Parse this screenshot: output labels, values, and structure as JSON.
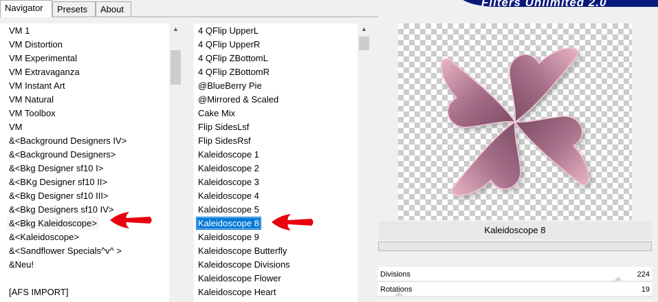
{
  "tabs": [
    {
      "label": "Navigator",
      "active": true
    },
    {
      "label": "Presets",
      "active": false
    },
    {
      "label": "About",
      "active": false
    }
  ],
  "brand": {
    "title": "Filters Unlimited 2.0"
  },
  "categories": {
    "items": [
      "VM 1",
      "VM Distortion",
      "VM Experimental",
      "VM Extravaganza",
      "VM Instant Art",
      "VM Natural",
      "VM Toolbox",
      "VM",
      "&<Background Designers IV>",
      "&<Background Designers>",
      "&<Bkg Designer sf10 I>",
      "&<BKg Designer sf10 II>",
      "&<Bkg Designer sf10 III>",
      "&<Bkg Designers sf10 IV>",
      "&<Bkg Kaleidoscope>",
      "&<Kaleidoscope>",
      "&<Sandflower Specials^v^ >",
      "&Neu!",
      "",
      "[AFS IMPORT]"
    ],
    "highlighted_index": 14,
    "scroll_fraction": 0.1
  },
  "filters": {
    "items": [
      "4 QFlip UpperL",
      "4 QFlip UpperR",
      "4 QFlip ZBottomL",
      "4 QFlip ZBottomR",
      "@BlueBerry Pie",
      "@Mirrored & Scaled",
      "Cake Mix",
      "Flip SidesLsf",
      "Flip SidesRsf",
      "Kaleidoscope 1",
      "Kaleidoscope 2",
      "Kaleidoscope 3",
      "Kaleidoscope 4",
      "Kaleidoscope 5",
      "Kaleidoscope 8",
      "Kaleidoscope 9",
      "Kaleidoscope Butterfly",
      "Kaleidoscope Divisions",
      "Kaleidoscope Flower",
      "Kaleidoscope Heart"
    ],
    "selected_index": 14,
    "scroll_fraction": 0.0
  },
  "preview": {
    "filter_name": "Kaleidoscope 8",
    "progress": 0
  },
  "params": [
    {
      "label": "Divisions",
      "value": "224",
      "fraction": 0.878
    },
    {
      "label": "Rotations",
      "value": "19",
      "fraction": 0.075
    }
  ],
  "colors": {
    "selection": "#0078d7",
    "arrow": "#e8000f",
    "petal": "#a8708a",
    "brand": "#0a1a7a"
  }
}
